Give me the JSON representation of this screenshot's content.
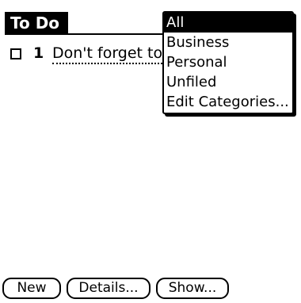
{
  "app": {
    "title": "To Do"
  },
  "task": {
    "checked": false,
    "priority": "1",
    "description": "Don't forget to"
  },
  "category_menu": {
    "selected": "All",
    "options": [
      "All",
      "Business",
      "Personal",
      "Unfiled",
      "Edit Categories..."
    ]
  },
  "buttons": {
    "new": "New",
    "details": "Details...",
    "show": "Show..."
  }
}
